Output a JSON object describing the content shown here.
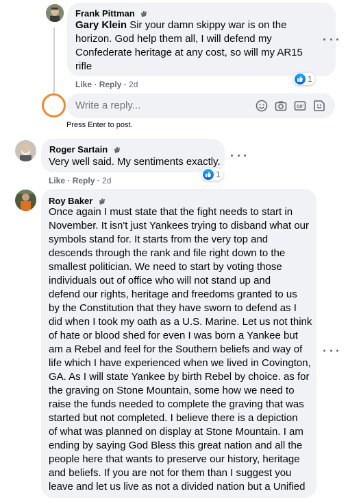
{
  "comments": [
    {
      "author": "Frank Pittman",
      "mention": "Gary Klein",
      "text_lines": [
        " Sir your damn skippy war is on the",
        "horizon. God help them all, I will defend my",
        "Confederate heritage at any cost, so will my AR15",
        "rifle"
      ],
      "like_label": "Like",
      "reply_label": "Reply",
      "time": "2d",
      "reaction_count": "1"
    },
    {
      "author": "Roger Sartain",
      "text_lines": [
        "Very well said. My sentiments exactly."
      ],
      "like_label": "Like",
      "reply_label": "Reply",
      "time": "2d",
      "reaction_count": "1"
    },
    {
      "author": "Roy Baker",
      "text_lines": [
        "Once again I must state that the fight needs to start in",
        "November. It isn't just Yankees trying to disband what our",
        "symbols stand for. It starts from the very top and",
        "descends through the rank and file right down to the",
        "smallest politician. We need to start by voting those",
        "individuals out of office who will not stand up and",
        "defend our rights, heritage and freedoms granted to us",
        "by the Constitution that they have sworn to defend as I",
        "did when I took my oath as a U.S. Marine. Let us not think",
        "of hate or blood shed for even I was born a Yankee but",
        "am a Rebel and feel for the Southern beliefs and way of",
        "life which I have experienced when we lived in Covington,",
        "GA. As I will state Yankee by birth Rebel by choice. as for",
        "the graving on Stone Mountain, some how we need to",
        "raise the funds needed to complete the graving that was",
        "started but not completed. I believe there is a depiction",
        "of what was planned on display at Stone Mountain. I am",
        "ending by saying God Bless this great nation and all the",
        "people here that wants to preserve our history, heritage",
        "and beliefs. If you are not for them than I suggest you",
        "leave and let us live as not a divided nation but a Unified"
      ]
    }
  ],
  "reply_box": {
    "placeholder": "Write a reply...",
    "hint": "Press Enter to post."
  },
  "icons": {
    "author_badge": "hand-wave-icon",
    "reaction": "like-thumb-icon",
    "more": "more-options-icon",
    "emoji": "emoji-icon",
    "camera": "camera-icon",
    "gif": "gif-icon",
    "sticker": "sticker-icon"
  },
  "colors": {
    "bubble_bg": "#f0f2f5",
    "secondary_text": "#65676b",
    "like_blue": "#1877f2",
    "highlight_circle": "#f5872a"
  }
}
